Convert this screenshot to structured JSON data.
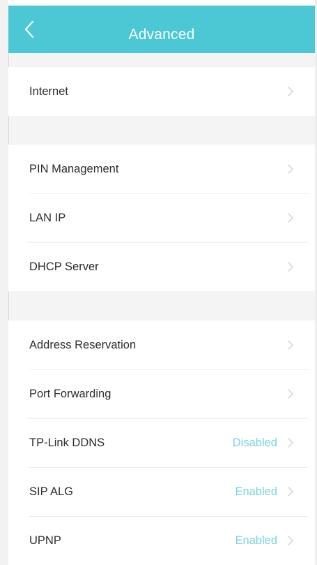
{
  "header": {
    "title": "Advanced"
  },
  "groups": [
    {
      "rows": [
        {
          "label": "Internet",
          "value": ""
        }
      ]
    },
    {
      "rows": [
        {
          "label": "PIN Management",
          "value": ""
        },
        {
          "label": "LAN IP",
          "value": ""
        },
        {
          "label": "DHCP Server",
          "value": ""
        }
      ]
    },
    {
      "rows": [
        {
          "label": "Address Reservation",
          "value": ""
        },
        {
          "label": "Port Forwarding",
          "value": ""
        },
        {
          "label": "TP-Link DDNS",
          "value": "Disabled"
        },
        {
          "label": "SIP ALG",
          "value": "Enabled"
        },
        {
          "label": "UPNP",
          "value": "Enabled"
        }
      ]
    }
  ],
  "colors": {
    "header_background": "#4cc8d5",
    "status_value": "#7ad3dc",
    "chevron": "#cfd2d6",
    "page_background": "#f4f4f5"
  },
  "icons": {
    "back": "back-chevron-icon",
    "row_chevron": "chevron-right-icon"
  }
}
